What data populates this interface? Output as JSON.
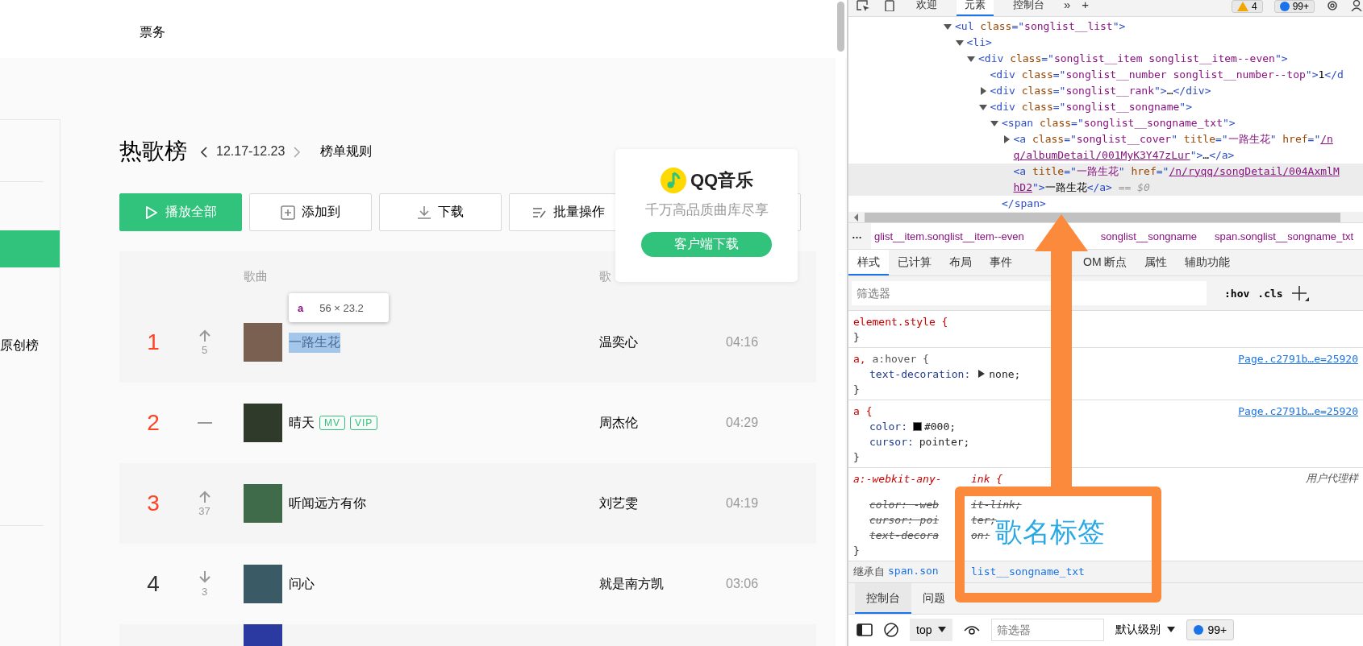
{
  "page": {
    "nav": {
      "items": [
        {
          "label": "票务"
        }
      ]
    },
    "sidebar": {
      "items": [
        {
          "selected": true
        },
        {
          "label": "原创榜",
          "selected": false
        }
      ]
    },
    "chart": {
      "title": "热歌榜",
      "period": "12.17-12.23",
      "rules_link": "榜单规则"
    },
    "toolbar": [
      {
        "label": "播放全部",
        "primary": true
      },
      {
        "label": "添加到",
        "primary": false
      },
      {
        "label": "下载",
        "primary": false
      },
      {
        "label": "批量操作",
        "primary": false
      }
    ],
    "table": {
      "columns": [
        "歌曲",
        "歌"
      ],
      "rows": [
        {
          "rank": "1",
          "top": true,
          "kind": "up",
          "change": "5",
          "title": "一路生花",
          "tags": [],
          "artist": "温奕心",
          "duration": "04:16",
          "inspected": true
        },
        {
          "rank": "2",
          "top": true,
          "kind": "same",
          "title": "晴天",
          "tags": [
            "MV",
            "VIP"
          ],
          "artist": "周杰伦",
          "duration": "04:29",
          "inspected": false
        },
        {
          "rank": "3",
          "top": true,
          "kind": "up",
          "change": "37",
          "title": "听闻远方有你",
          "tags": [],
          "artist": "刘艺雯",
          "duration": "04:19",
          "inspected": false
        },
        {
          "rank": "4",
          "top": false,
          "kind": "down",
          "change": "3",
          "title": "问心",
          "tags": [],
          "artist": "就是南方凯",
          "duration": "03:06",
          "inspected": false
        }
      ]
    },
    "inspect_tooltip": {
      "tag": "a",
      "size": "56 × 23.2"
    },
    "promo": {
      "brand": "QQ音乐",
      "tagline": "千万高品质曲库尽享",
      "button": "客户端下载"
    }
  },
  "devtools": {
    "toolbar": {
      "tabs": [
        {
          "label": "欢迎",
          "selected": false
        },
        {
          "label": "元素",
          "selected": true
        },
        {
          "label": "控制台",
          "selected": false
        }
      ],
      "more": "»",
      "add": "+",
      "warnings": "4",
      "messages": "99+"
    },
    "dom": [
      {
        "expanded": true,
        "lines": [
          [
            {
              "kind": "p",
              "s": "<ul"
            },
            {
              "kind": "n",
              "s": " class"
            },
            {
              "kind": "p",
              "s": "=\""
            },
            {
              "kind": "v",
              "s": "songlist__list"
            },
            {
              "kind": "p",
              "s": "\">"
            }
          ]
        ],
        "children": [
          {
            "expanded": true,
            "lines": [
              [
                {
                  "kind": "p",
                  "s": "<li>"
                }
              ]
            ],
            "children": [
              {
                "expanded": true,
                "lines": [
                  [
                    {
                      "kind": "p",
                      "s": "<div"
                    },
                    {
                      "kind": "n",
                      "s": " class"
                    },
                    {
                      "kind": "p",
                      "s": "=\""
                    },
                    {
                      "kind": "v",
                      "s": "songlist__item songlist__item--even"
                    },
                    {
                      "kind": "p",
                      "s": "\">"
                    }
                  ]
                ],
                "children": [
                  {
                    "lines": [
                      [
                        {
                          "kind": "p",
                          "s": "<div"
                        },
                        {
                          "kind": "n",
                          "s": " class"
                        },
                        {
                          "kind": "p",
                          "s": "=\""
                        },
                        {
                          "kind": "v",
                          "s": "songlist__number songlist__number--top"
                        },
                        {
                          "kind": "p",
                          "s": "\">"
                        },
                        {
                          "kind": "x",
                          "s": "1"
                        },
                        {
                          "kind": "p",
                          "s": "</d"
                        }
                      ]
                    ]
                  },
                  {
                    "expanded": false,
                    "lines": [
                      [
                        {
                          "kind": "p",
                          "s": "<div"
                        },
                        {
                          "kind": "n",
                          "s": " class"
                        },
                        {
                          "kind": "p",
                          "s": "=\""
                        },
                        {
                          "kind": "v",
                          "s": "songlist__rank"
                        },
                        {
                          "kind": "p",
                          "s": "\">"
                        },
                        {
                          "kind": "x",
                          "s": "…"
                        },
                        {
                          "kind": "p",
                          "s": "</div>"
                        }
                      ]
                    ]
                  },
                  {
                    "expanded": true,
                    "lines": [
                      [
                        {
                          "kind": "p",
                          "s": "<div"
                        },
                        {
                          "kind": "n",
                          "s": " class"
                        },
                        {
                          "kind": "p",
                          "s": "=\""
                        },
                        {
                          "kind": "v",
                          "s": "songlist__songname"
                        },
                        {
                          "kind": "p",
                          "s": "\">"
                        }
                      ]
                    ],
                    "children": [
                      {
                        "expanded": true,
                        "close": "</span>",
                        "lines": [
                          [
                            {
                              "kind": "p",
                              "s": "<span"
                            },
                            {
                              "kind": "n",
                              "s": " class"
                            },
                            {
                              "kind": "p",
                              "s": "=\""
                            },
                            {
                              "kind": "v",
                              "s": "songlist__songname_txt"
                            },
                            {
                              "kind": "p",
                              "s": "\">"
                            }
                          ]
                        ],
                        "children": [
                          {
                            "expanded": false,
                            "lines": [
                              [
                                {
                                  "kind": "p",
                                  "s": "<a"
                                },
                                {
                                  "kind": "n",
                                  "s": " class"
                                },
                                {
                                  "kind": "p",
                                  "s": "=\""
                                },
                                {
                                  "kind": "v",
                                  "s": "songlist__cover"
                                },
                                {
                                  "kind": "p",
                                  "s": "\""
                                },
                                {
                                  "kind": "n",
                                  "s": " title"
                                },
                                {
                                  "kind": "p",
                                  "s": "=\""
                                },
                                {
                                  "kind": "v",
                                  "s": "一路生花"
                                },
                                {
                                  "kind": "p",
                                  "s": "\""
                                },
                                {
                                  "kind": "n",
                                  "s": " href"
                                },
                                {
                                  "kind": "p",
                                  "s": "=\""
                                },
                                {
                                  "kind": "l",
                                  "s": "/n"
                                }
                              ],
                              [
                                {
                                  "kind": "l",
                                  "s": "q/albumDetail/001MyK3Y47zLur"
                                },
                                {
                                  "kind": "p",
                                  "s": "\">"
                                },
                                {
                                  "kind": "x",
                                  "s": "…"
                                },
                                {
                                  "kind": "p",
                                  "s": "</a>"
                                }
                              ]
                            ]
                          },
                          {
                            "selected": true,
                            "lines": [
                              [
                                {
                                  "kind": "p",
                                  "s": "<a"
                                },
                                {
                                  "kind": "n",
                                  "s": " title"
                                },
                                {
                                  "kind": "p",
                                  "s": "=\""
                                },
                                {
                                  "kind": "v",
                                  "s": "一路生花"
                                },
                                {
                                  "kind": "p",
                                  "s": "\""
                                },
                                {
                                  "kind": "n",
                                  "s": " href"
                                },
                                {
                                  "kind": "p",
                                  "s": "=\""
                                },
                                {
                                  "kind": "l",
                                  "s": "/n/ryqq/songDetail/004AxmlM"
                                }
                              ],
                              [
                                {
                                  "kind": "l",
                                  "s": "hD2"
                                },
                                {
                                  "kind": "p",
                                  "s": "\">"
                                },
                                {
                                  "kind": "x",
                                  "s": "一路生花"
                                },
                                {
                                  "kind": "p",
                                  "s": "</a>"
                                },
                                {
                                  "kind": "c",
                                  "s": " == $0"
                                }
                              ]
                            ]
                          }
                        ]
                      }
                    ]
                  }
                ]
              }
            ]
          }
        ]
      }
    ],
    "breadcrumbs": [
      "…",
      "glist__item.songlist__item--even",
      "songlist__songname",
      "span.songlist__songname_txt"
    ],
    "styles_tabs": [
      {
        "label": "样式",
        "selected": true
      },
      {
        "label": "已计算",
        "selected": false
      },
      {
        "label": "布局",
        "selected": false
      },
      {
        "label": "事件",
        "selected": false
      },
      {
        "label": "OM 断点",
        "selected": false
      },
      {
        "label": "属性",
        "selected": false
      },
      {
        "label": "辅助功能",
        "selected": false
      }
    ],
    "filter": {
      "placeholder": "筛选器",
      "hov": ":hov",
      "cls": ".cls"
    },
    "rules": [
      {
        "selector": [
          {
            "s": "element.style {",
            "match": true
          }
        ],
        "close": "}"
      },
      {
        "selector": [
          {
            "s": "a, ",
            "match": true
          },
          {
            "s": "a:hover {",
            "match": false
          }
        ],
        "source": "Page.c2791b…e=25920",
        "close": "}",
        "declarations": [
          {
            "kind": "decl",
            "name": "text-decoration:",
            "value": "none;",
            "expander": true
          }
        ]
      },
      {
        "selector": [
          {
            "s": "a {",
            "match": true
          }
        ],
        "source": "Page.c2791b…e=25920",
        "close": "}",
        "declarations": [
          {
            "kind": "decl",
            "name": "color:",
            "value": "#000;",
            "swatch": true
          },
          {
            "kind": "decl",
            "name": "cursor:",
            "value": "pointer;"
          }
        ]
      },
      {
        "selector_parts": [
          "a:-webkit-any-",
          "ink {"
        ],
        "origin": "用户代理样",
        "close": "}",
        "declarations": [
          {
            "kind": "split",
            "parts": [
              "color: -web",
              "it-link;"
            ],
            "struck": true
          },
          {
            "kind": "split",
            "parts": [
              "cursor: poi",
              "ter;"
            ],
            "struck": true
          },
          {
            "kind": "split",
            "parts": [
              "text-decora",
              "on:"
            ],
            "struck": true
          }
        ]
      }
    ],
    "inherited": {
      "label": "继承自",
      "parts": [
        "span.son",
        "list__songname_txt"
      ]
    },
    "drawer": {
      "tabs": [
        {
          "label": "控制台",
          "selected": true
        },
        {
          "label": "问题",
          "selected": false
        }
      ],
      "context": "top",
      "filter_placeholder": "筛选器",
      "level": "默认级别",
      "messages": "99+"
    }
  },
  "annotation": {
    "label": "歌名标签"
  }
}
